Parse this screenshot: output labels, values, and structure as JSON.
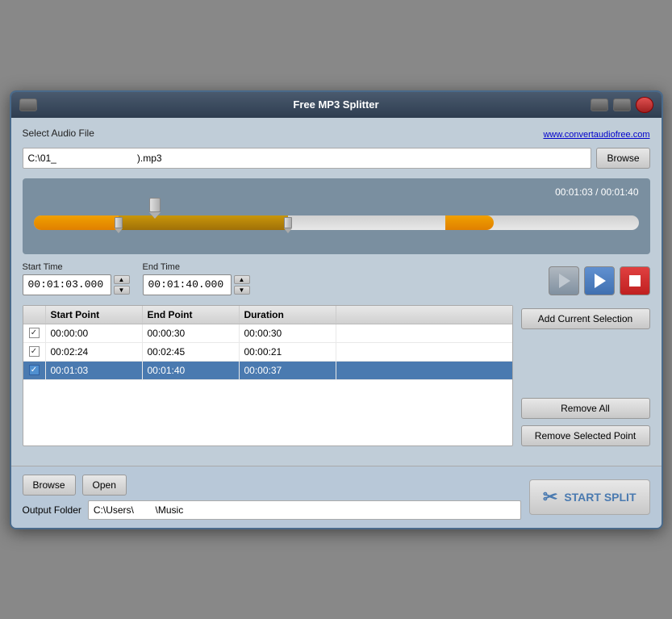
{
  "window": {
    "title": "Free MP3 Splitter"
  },
  "header": {
    "select_audio_label": "Select Audio File",
    "website_link": "www.convertaudiofree.com"
  },
  "file": {
    "path": "C:\\01_                              ).mp3",
    "browse_label": "Browse"
  },
  "timeline": {
    "current_time": "00:01:03",
    "total_time": "00:01:40",
    "time_display": "00:01:03 / 00:01:40"
  },
  "start_time": {
    "label": "Start Time",
    "value": "00:01:03.000"
  },
  "end_time": {
    "label": "End Time",
    "value": "00:01:40.000"
  },
  "table": {
    "headers": [
      "",
      "Start Point",
      "End Point",
      "Duration"
    ],
    "rows": [
      {
        "checked": true,
        "start": "00:00:00",
        "end": "00:00:30",
        "duration": "00:00:30",
        "selected": false
      },
      {
        "checked": true,
        "start": "00:02:24",
        "end": "00:02:45",
        "duration": "00:00:21",
        "selected": false
      },
      {
        "checked": true,
        "start": "00:01:03",
        "end": "00:01:40",
        "duration": "00:00:37",
        "selected": true
      }
    ]
  },
  "buttons": {
    "add_selection": "Add Current Selection",
    "remove_all": "Remove All",
    "remove_selected": "Remove Selected Point",
    "browse": "Browse",
    "open": "Open",
    "start_split": "START SPLIT"
  },
  "output": {
    "label": "Output Folder",
    "path": "C:\\Users\\        \\Music"
  }
}
